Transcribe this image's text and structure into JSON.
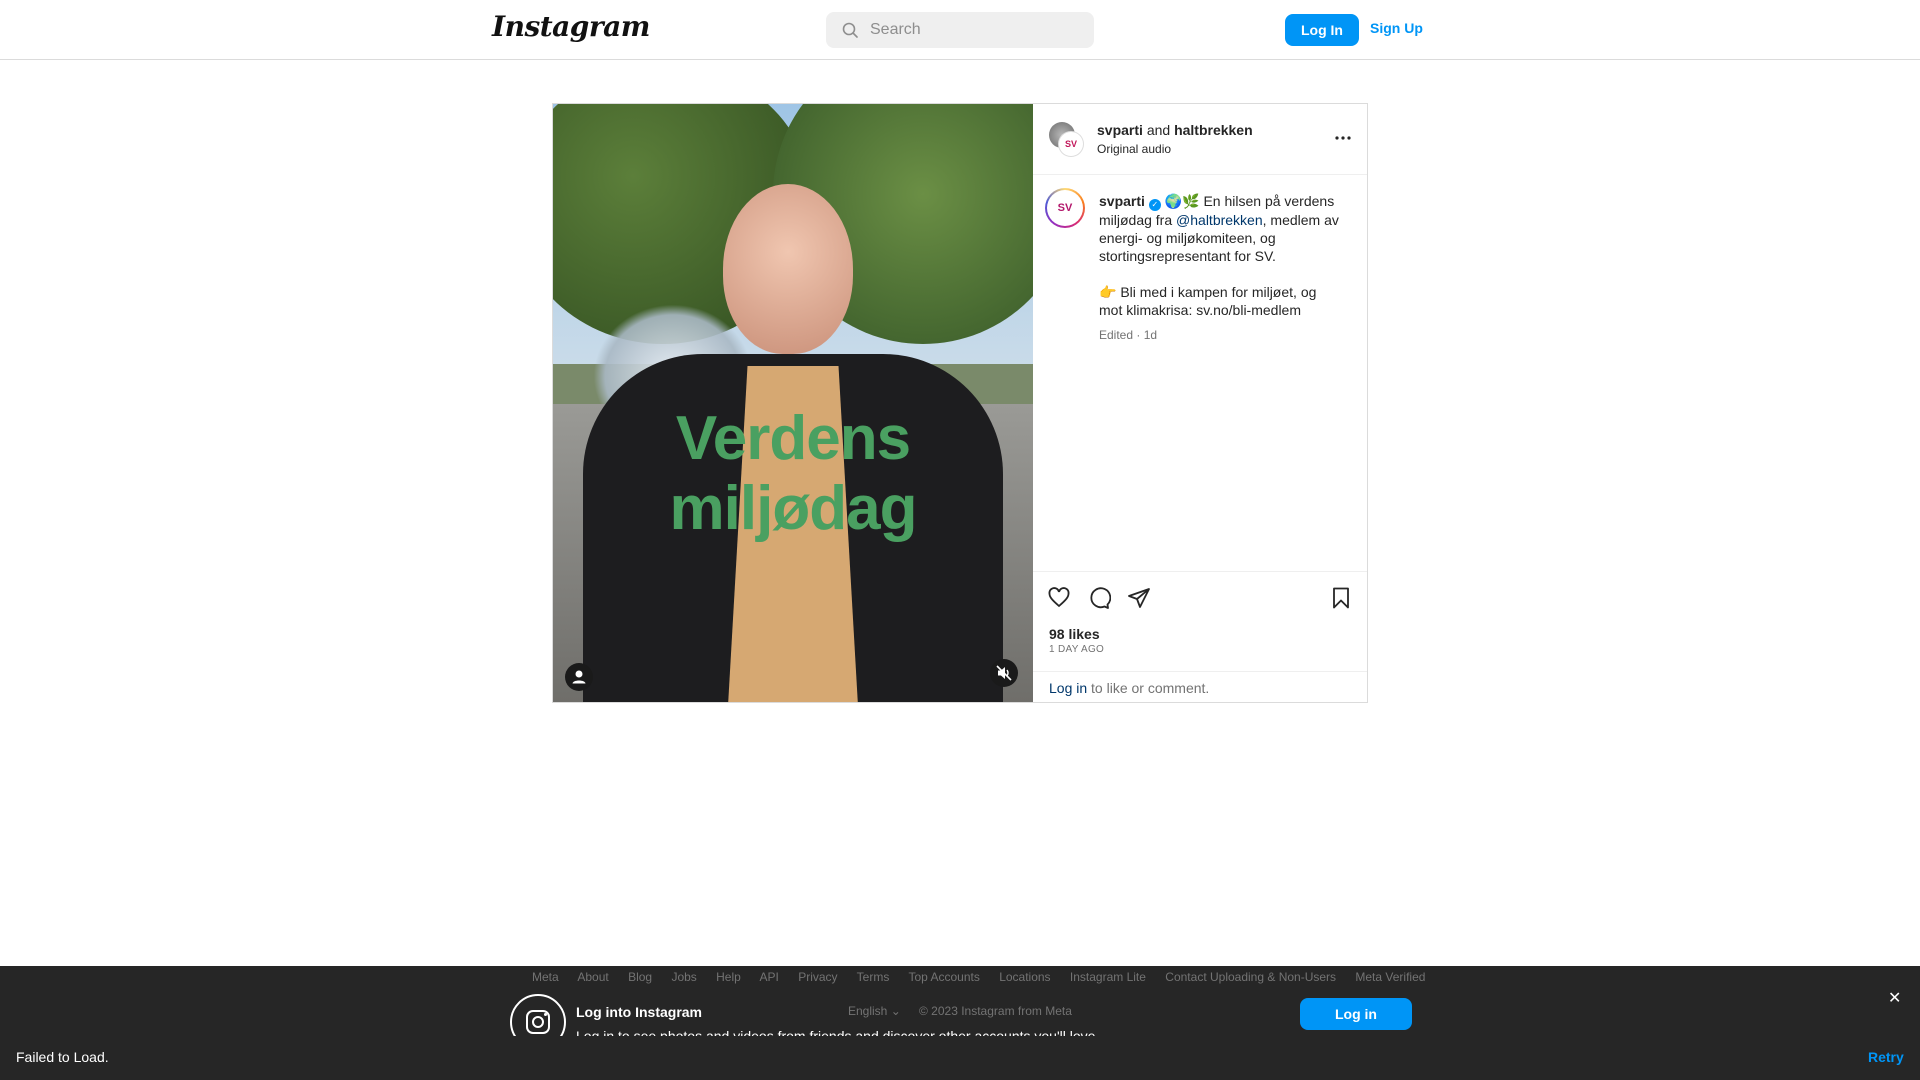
{
  "nav": {
    "logo": "Instagram",
    "search_placeholder": "Search",
    "login_label": "Log In",
    "signup_label": "Sign Up"
  },
  "post": {
    "overlay_text_line1": "Verdens",
    "overlay_text_line2": "miljødag",
    "author1": "svparti",
    "and": "and",
    "author2": "haltbrekken",
    "audio": "Original audio",
    "caption": {
      "username": "svparti",
      "verified_mark": "✓",
      "text_pre": " 🌍🌿 En hilsen på verdens miljødag fra ",
      "mention": "@haltbrekken",
      "text_post": ", medlem av energi- og miljøkomiteen, og stortingsrepresentant for SV.",
      "line2": "👉 Bli med i kampen for miljøet, og mot klimakrisa: sv.no/bli-medlem",
      "meta": "Edited · 1d"
    },
    "avatar_text": "SV",
    "likes": "98 likes",
    "time_ago": "1 DAY AGO",
    "login_link": "Log in",
    "login_rest": " to like or comment."
  },
  "footer": {
    "links": [
      "Meta",
      "About",
      "Blog",
      "Jobs",
      "Help",
      "API",
      "Privacy",
      "Terms",
      "Top Accounts",
      "Locations",
      "Instagram Lite",
      "Contact Uploading & Non-Users",
      "Meta Verified"
    ],
    "language": "English ⌄",
    "copyright": "© 2023 Instagram from Meta",
    "banner_title": "Log into Instagram",
    "banner_sub": "Log in to see photos and videos from friends and discover other accounts you'll love.",
    "banner_login": "Log in",
    "close": "✕"
  },
  "status": {
    "fail_text": "Failed to Load.",
    "retry": "Retry"
  },
  "colors": {
    "accent": "#0095f6",
    "overlay_green": "#4aa061",
    "banner_bg": "#262626"
  }
}
